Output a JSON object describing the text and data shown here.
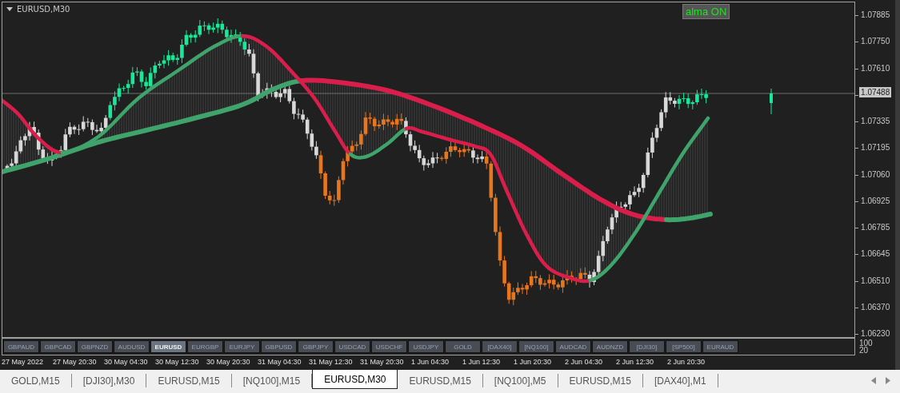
{
  "chart": {
    "title": "EURUSD,M30",
    "indicator_button": "alma ON",
    "current_price": "1.07488",
    "price_axis": [
      "1.07885",
      "1.07750",
      "1.07610",
      "1.07335",
      "1.07195",
      "1.07060",
      "1.06925",
      "1.06785",
      "1.06645",
      "1.06510",
      "1.06370",
      "1.06230"
    ]
  },
  "symbol_buttons": [
    {
      "label": "GBPAUD",
      "selected": false
    },
    {
      "label": "GBPCAD",
      "selected": false
    },
    {
      "label": "GBPNZD",
      "selected": false
    },
    {
      "label": "AUDUSD",
      "selected": false
    },
    {
      "label": "EURUSD",
      "selected": true
    },
    {
      "label": "EURGBP",
      "selected": false
    },
    {
      "label": "EURJPY",
      "selected": false
    },
    {
      "label": "GBPUSD",
      "selected": false
    },
    {
      "label": "GBPJPY",
      "selected": false
    },
    {
      "label": "USDCAD",
      "selected": false
    },
    {
      "label": "USDCHF",
      "selected": false
    },
    {
      "label": "USDJPY",
      "selected": false
    },
    {
      "label": "GOLD",
      "selected": false
    },
    {
      "label": "[DAX40]",
      "selected": false
    },
    {
      "label": "[NQ100]",
      "selected": false
    },
    {
      "label": "AUDCAD",
      "selected": false
    },
    {
      "label": "AUDNZD",
      "selected": false
    },
    {
      "label": "[DJI30]",
      "selected": false
    },
    {
      "label": "[SP500]",
      "selected": false
    },
    {
      "label": "EURAUD",
      "selected": false
    }
  ],
  "sub_axis": [
    "100",
    "20"
  ],
  "time_axis": [
    "27 May 2022",
    "27 May 20:30",
    "30 May 04:30",
    "30 May 12:30",
    "30 May 20:30",
    "31 May 04:30",
    "31 May 12:30",
    "31 May 20:30",
    "1 Jun 04:30",
    "1 Jun 12:30",
    "1 Jun 20:30",
    "2 Jun 04:30",
    "2 Jun 12:30",
    "2 Jun 20:30"
  ],
  "tabs": [
    {
      "label": "GOLD,M15",
      "selected": false
    },
    {
      "label": "[DJI30],M30",
      "selected": false
    },
    {
      "label": "EURUSD,M15",
      "selected": false
    },
    {
      "label": "[NQ100],M15",
      "selected": false
    },
    {
      "label": "EURUSD,M30",
      "selected": true
    },
    {
      "label": "EURUSD,M15",
      "selected": false
    },
    {
      "label": "[NQ100],M5",
      "selected": false
    },
    {
      "label": "EURUSD,M15",
      "selected": false
    },
    {
      "label": "[DAX40],M1",
      "selected": false
    }
  ]
}
